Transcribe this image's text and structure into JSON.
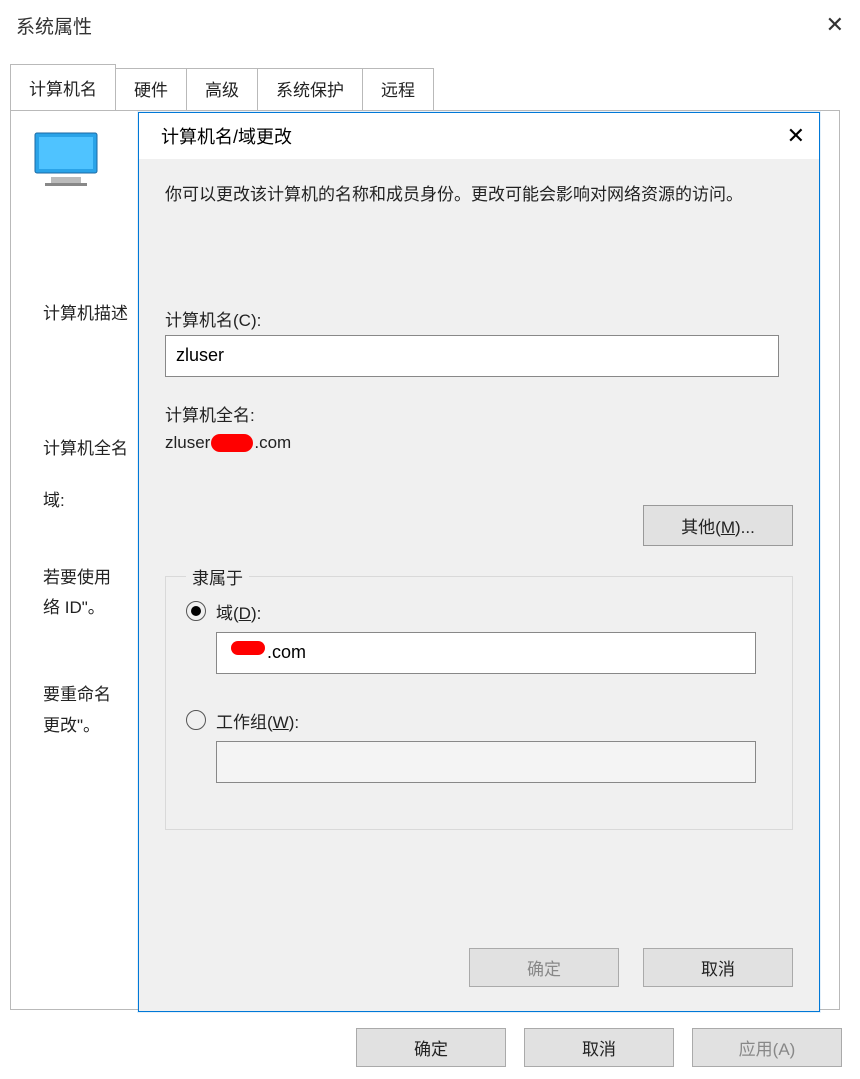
{
  "outer": {
    "title": "系统属性",
    "tabs": [
      "计算机名",
      "硬件",
      "高级",
      "系统保护",
      "远程"
    ],
    "left_labels": {
      "desc": "计算机描述",
      "fullname": "计算机全名",
      "domain": "域:",
      "use_wizard_line1": "若要使用",
      "use_wizard_line2": "络 ID\"。",
      "rename_line1": "要重命名",
      "rename_line2": "更改\"。"
    },
    "buttons": {
      "ok": "确定",
      "cancel": "取消",
      "apply": "应用(A)"
    }
  },
  "inner": {
    "title": "计算机名/域更改",
    "intro": "你可以更改该计算机的名称和成员身份。更改可能会影响对网络资源的访问。",
    "computer_name_label": "计算机名(C):",
    "computer_name_value": "zluser",
    "fullname_label": "计算机全名:",
    "fullname_prefix": "zluser",
    "fullname_suffix": ".com",
    "other_button": "其他(M)...",
    "group_legend": "隶属于",
    "domain_label": "域(D):",
    "domain_value_suffix": ".com",
    "workgroup_label": "工作组(W):",
    "workgroup_value": "",
    "buttons": {
      "ok": "确定",
      "cancel": "取消"
    }
  }
}
